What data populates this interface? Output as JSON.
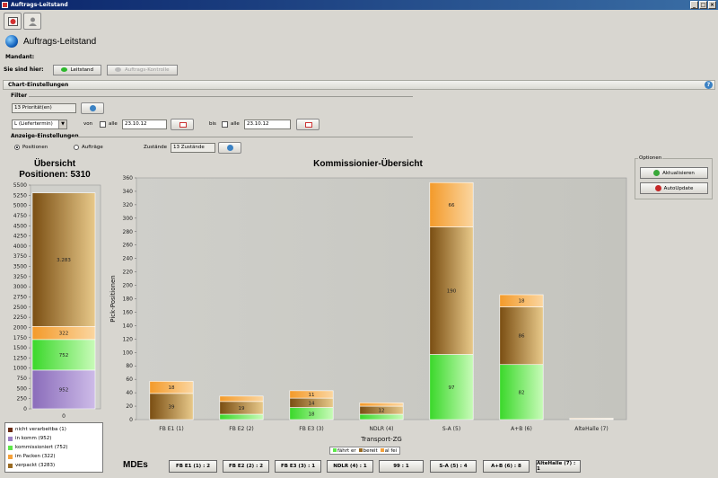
{
  "window": {
    "title": "Auftrags-Leitstand",
    "min_label": "_",
    "max_label": "□",
    "close_label": "×"
  },
  "header": {
    "title": "Auftrags-Leitstand",
    "mandant_label": "Mandant:"
  },
  "breadcrumb": {
    "label": "Sie sind hier:",
    "items": [
      "Leitstand",
      "Auftrags-Kontrolle"
    ]
  },
  "chart_settings": {
    "title": "Chart-Einstellungen",
    "help": "?"
  },
  "filter": {
    "title": "Filter",
    "priorities_value": "13 Priorität(en)",
    "date_type_value": "L (Liefertermin)",
    "from_label": "von",
    "from_all_label": "alle",
    "from_date": "23.10.12",
    "to_label": "bis",
    "to_all_label": "alle",
    "to_date": "23.10.12"
  },
  "display": {
    "title": "Anzeige-Einstellungen",
    "radio_positions": "Positionen",
    "radio_orders": "Aufträge",
    "states_label": "Zustände",
    "states_value": "13 Zustände"
  },
  "options": {
    "title": "Optionen",
    "refresh_label": "Aktualisieren",
    "autoupdate_label": "AutoUpdate"
  },
  "colors": {
    "purple": "#9b7fc4",
    "green": "#5ee84a",
    "orange": "#f5a13a",
    "brown": "#9a6b22",
    "dark": "#6b2c14"
  },
  "overview": {
    "title_line1": "Übersicht",
    "title_line2": "Positionen: 5310",
    "chart_data": {
      "type": "bar",
      "title": "Übersicht Positionen: 5310",
      "categories": [
        "0"
      ],
      "ylim": [
        0,
        5500
      ],
      "yticks": [
        0,
        250,
        500,
        750,
        1000,
        1250,
        1500,
        1750,
        2000,
        2250,
        2500,
        2750,
        3000,
        3250,
        3500,
        3750,
        4000,
        4250,
        4500,
        4750,
        5000,
        5250,
        5500
      ],
      "series": [
        {
          "name": "in komm",
          "values": [
            952
          ],
          "label": "952"
        },
        {
          "name": "kommissioniert",
          "values": [
            752
          ],
          "label": "752"
        },
        {
          "name": "im Packen",
          "values": [
            322
          ],
          "label": "322"
        },
        {
          "name": "verpackt",
          "values": [
            3283
          ],
          "label": "3.283"
        }
      ]
    },
    "legend": [
      {
        "text": "nicht verarbeitba (1)",
        "color": "#6b2c14"
      },
      {
        "text": "in komm (952)",
        "color": "#9b7fc4"
      },
      {
        "text": "kommissioniert (752)",
        "color": "#5ee84a"
      },
      {
        "text": "im Packen (322)",
        "color": "#f5a13a"
      },
      {
        "text": "verpackt (3283)",
        "color": "#9a6b22"
      }
    ]
  },
  "main": {
    "title": "Kommissionier-Übersicht",
    "chart_data": {
      "type": "bar",
      "title": "Kommissionier-Übersicht",
      "xlabel": "Transport-ZG",
      "ylabel": "Pick-Positionen",
      "ylim": [
        0,
        360
      ],
      "yticks": [
        0,
        20,
        40,
        60,
        80,
        100,
        120,
        140,
        160,
        180,
        200,
        220,
        240,
        260,
        280,
        300,
        320,
        340,
        360
      ],
      "categories": [
        "FB E1 (1)",
        "FB E2 (2)",
        "FB E3 (3)",
        "NDLR (4)",
        "S-A (5)",
        "A+B (6)",
        "AlteHalle (7)"
      ],
      "series": [
        {
          "name": "fährt er",
          "values": [
            0,
            8,
            18,
            8,
            97,
            82,
            0
          ],
          "labels": [
            "",
            "",
            "18",
            "",
            "97",
            "82",
            ""
          ]
        },
        {
          "name": "bereit",
          "values": [
            39,
            19,
            14,
            12,
            190,
            86,
            1
          ],
          "labels": [
            "39",
            "19",
            "14",
            "12",
            "190",
            "86",
            ""
          ]
        },
        {
          "name": "al fei",
          "values": [
            18,
            8,
            11,
            5,
            66,
            18,
            1
          ],
          "labels": [
            "18",
            "",
            "11",
            "",
            "66",
            "18",
            ""
          ]
        }
      ]
    },
    "mini_legend": [
      "fährt er",
      "bereit",
      "al fei"
    ]
  },
  "mdes": {
    "label": "MDEs",
    "items": [
      "FB E1 (1) : 2",
      "FB E2 (2) : 2",
      "FB E3 (3) : 1",
      "NDLR (4) : 1",
      "99 : 1",
      "S-A (5) : 4",
      "A+B (6) : 8",
      "AlteHalle (7) : 1"
    ]
  }
}
